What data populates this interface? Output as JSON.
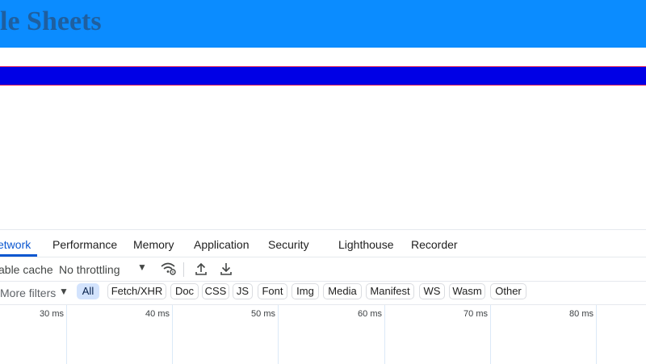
{
  "page": {
    "title": "le Sheets",
    "colors": {
      "header_bg": "#0b8cff",
      "title": "#1f5f9f",
      "bar": "#0000e6",
      "bar_border": "#e0245e"
    }
  },
  "devtools": {
    "tabs": [
      {
        "label": "etwork",
        "active": true
      },
      {
        "label": "Performance"
      },
      {
        "label": "Memory"
      },
      {
        "label": "Application"
      },
      {
        "label": "Security"
      },
      {
        "label": "Lighthouse"
      },
      {
        "label": "Recorder"
      }
    ],
    "toolbar": {
      "cache_label": "able cache",
      "throttling_value": "No throttling",
      "icons": [
        "caret-down-icon",
        "network-conditions-icon",
        "upload-icon",
        "download-icon"
      ]
    },
    "filters": {
      "more_filters_label": "More filters",
      "chips": [
        {
          "label": "All",
          "active": true
        },
        {
          "label": "Fetch/XHR"
        },
        {
          "label": "Doc"
        },
        {
          "label": "CSS"
        },
        {
          "label": "JS"
        },
        {
          "label": "Font"
        },
        {
          "label": "Img"
        },
        {
          "label": "Media"
        },
        {
          "label": "Manifest"
        },
        {
          "label": "WS"
        },
        {
          "label": "Wasm"
        },
        {
          "label": "Other"
        }
      ]
    },
    "timeline": {
      "ticks": [
        "30 ms",
        "40 ms",
        "50 ms",
        "60 ms",
        "70 ms",
        "80 ms"
      ]
    },
    "colors": {
      "accent": "#0b57d0",
      "chip_active_bg": "#d3e3fd",
      "grid": "#dbe9f7"
    }
  }
}
